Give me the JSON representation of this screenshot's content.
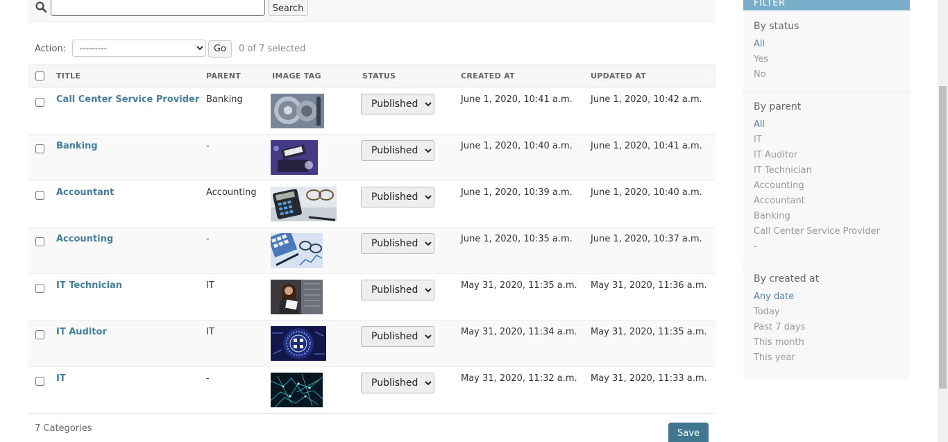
{
  "search": {
    "value": "",
    "button_label": "Search"
  },
  "actions": {
    "label": "Action:",
    "selected_option": "---------",
    "go_label": "Go",
    "selection_counter": "0 of 7 selected"
  },
  "table": {
    "columns": [
      "TITLE",
      "PARENT",
      "IMAGE TAG",
      "STATUS",
      "CREATED AT",
      "UPDATED AT"
    ],
    "rows": [
      {
        "title": "Call Center Service Provider",
        "parent": "Banking",
        "status": "Published",
        "created": "June 1, 2020, 10:41 a.m.",
        "updated": "June 1, 2020, 10:42 a.m.",
        "image_icon": "vault-image"
      },
      {
        "title": "Banking",
        "parent": "-",
        "status": "Published",
        "created": "June 1, 2020, 10:40 a.m.",
        "updated": "June 1, 2020, 10:41 a.m.",
        "image_icon": "banking-image"
      },
      {
        "title": "Accountant",
        "parent": "Accounting",
        "status": "Published",
        "created": "June 1, 2020, 10:39 a.m.",
        "updated": "June 1, 2020, 10:40 a.m.",
        "image_icon": "calculator-image"
      },
      {
        "title": "Accounting",
        "parent": "-",
        "status": "Published",
        "created": "June 1, 2020, 10:35 a.m.",
        "updated": "June 1, 2020, 10:37 a.m.",
        "image_icon": "accounting-image"
      },
      {
        "title": "IT Technician",
        "parent": "IT",
        "status": "Published",
        "created": "May 31, 2020, 11:35 a.m.",
        "updated": "May 31, 2020, 11:36 a.m.",
        "image_icon": "technician-image"
      },
      {
        "title": "IT Auditor",
        "parent": "IT",
        "status": "Published",
        "created": "May 31, 2020, 11:34 a.m.",
        "updated": "May 31, 2020, 11:35 a.m.",
        "image_icon": "auditor-image"
      },
      {
        "title": "IT",
        "parent": "-",
        "status": "Published",
        "created": "May 31, 2020, 11:32 a.m.",
        "updated": "May 31, 2020, 11:33 a.m.",
        "image_icon": "network-image"
      }
    ]
  },
  "footer": {
    "count": "7 Categories",
    "save_label": "Save"
  },
  "filter": {
    "header": "FILTER",
    "by_status": {
      "title": "By status",
      "items": [
        "All",
        "Yes",
        "No"
      ],
      "selected": "All"
    },
    "by_parent": {
      "title": "By parent",
      "items": [
        "All",
        "IT",
        "IT Auditor",
        "IT Technician",
        "Accounting",
        "Accountant",
        "Banking",
        "Call Center Service Provider",
        "-"
      ],
      "selected": "All"
    },
    "by_created": {
      "title": "By created at",
      "items": [
        "Any date",
        "Today",
        "Past 7 days",
        "This month",
        "This year"
      ],
      "selected": "Any date"
    }
  },
  "colors": {
    "link": "#447e9b",
    "filter_header": "#79aec8",
    "save_button": "#417690",
    "selected_filter": "#5b80b2"
  }
}
